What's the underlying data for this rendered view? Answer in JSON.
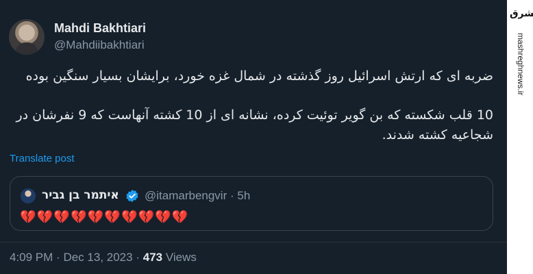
{
  "author": {
    "display_name": "Mahdi Bakhtiari",
    "handle": "@Mahdiibakhtiari"
  },
  "tweet": {
    "paragraph_1": "ضربه ای که ارتش اسرائیل روز گذشته در شمال غزه خورد، برایشان بسیار سنگین بوده",
    "paragraph_2": "10 قلب شکسته که بن گویر توئیت کرده، نشانه ای از 10 کشته آنهاست که 9 نفرشان در شجاعیه کشته شدند."
  },
  "translate_label": "Translate post",
  "quoted": {
    "display_name": "איתמר בן גביר",
    "handle": "@itamarbengvir",
    "separator": "·",
    "time": "5h",
    "content": "💔💔💔💔💔💔💔💔💔💔"
  },
  "footer": {
    "time": "4:09 PM",
    "sep1": "·",
    "date": "Dec 13, 2023",
    "sep2": "·",
    "views_count": "473",
    "views_label": "Views"
  },
  "watermark": {
    "logo_text": "مشرق",
    "url": "mashreghnews.ir"
  },
  "colors": {
    "background": "#15202b",
    "link": "#1d9bf0",
    "muted": "#8b98a5",
    "verified": "#1d9bf0"
  },
  "icons": [
    "verified-badge-icon",
    "broken-heart-icon"
  ]
}
